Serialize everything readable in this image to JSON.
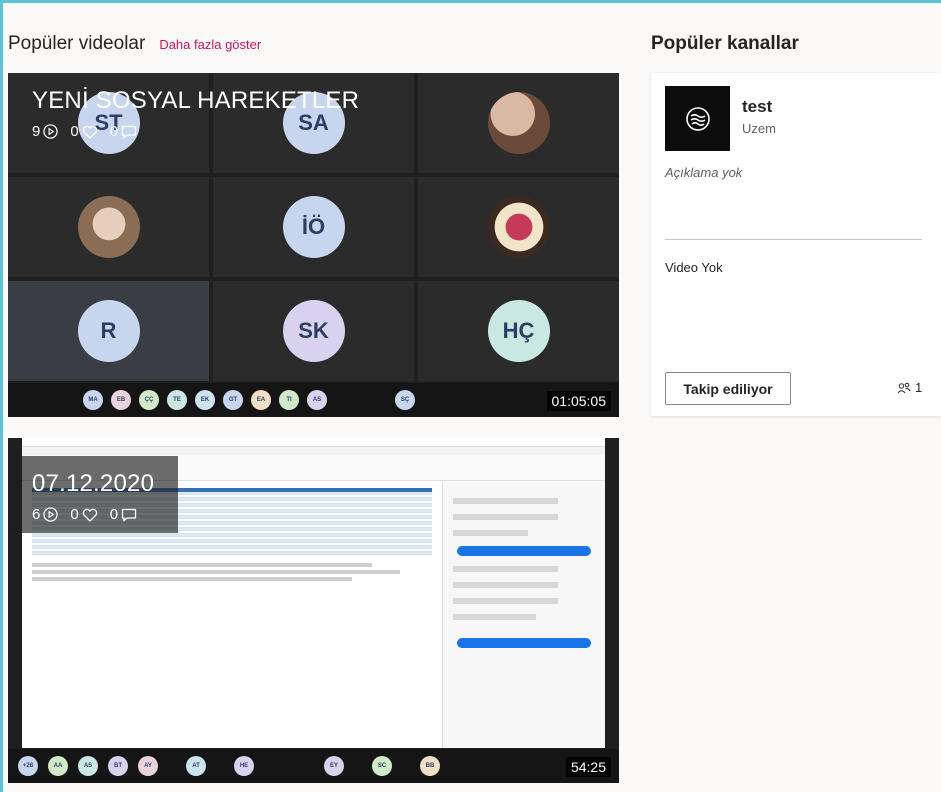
{
  "popular_videos": {
    "title": "Popüler videolar",
    "more_link": "Daha fazla göster",
    "videos": [
      {
        "title": "YENİ SOSYAL HAREKETLER",
        "views": "9",
        "likes": "0",
        "comments": "0",
        "duration": "01:05:05",
        "grid_initials": [
          "ST",
          "SA",
          "",
          "",
          "İÖ",
          "",
          "R",
          "SK",
          "HÇ"
        ],
        "strip_initials": [
          "MA",
          "EB",
          "ÇÇ",
          "TE",
          "EK",
          "GT",
          "EA",
          "TI",
          "AS",
          "SÇ"
        ]
      },
      {
        "title": "07.12.2020",
        "views": "6",
        "likes": "0",
        "comments": "0",
        "duration": "54:25",
        "strip_initials": [
          "+28",
          "AA",
          "AS",
          "BT",
          "AY",
          "AT",
          "HE",
          "EY",
          "SC",
          "BB"
        ]
      }
    ]
  },
  "popular_channels": {
    "title": "Popüler kanallar",
    "channel": {
      "name": "test",
      "subtitle": "Uzem",
      "description": "Açıklama yok",
      "videos_text": "Video Yok",
      "follow_label": "Takip ediliyor",
      "followers": "1"
    }
  },
  "colors": {
    "accent_link": "#c5175b",
    "frame": "#5ec3d6"
  }
}
